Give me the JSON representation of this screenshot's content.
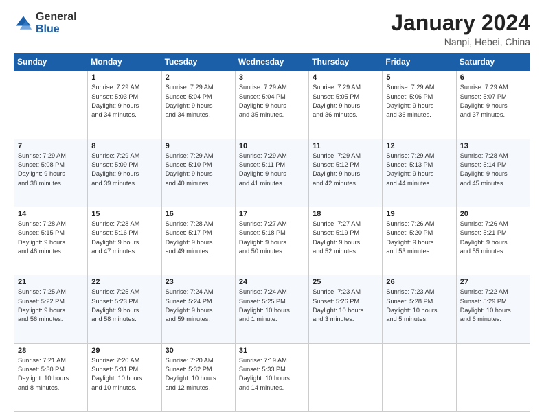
{
  "logo": {
    "general": "General",
    "blue": "Blue"
  },
  "header": {
    "month": "January 2024",
    "location": "Nanpi, Hebei, China"
  },
  "weekdays": [
    "Sunday",
    "Monday",
    "Tuesday",
    "Wednesday",
    "Thursday",
    "Friday",
    "Saturday"
  ],
  "weeks": [
    [
      {
        "day": "",
        "info": ""
      },
      {
        "day": "1",
        "info": "Sunrise: 7:29 AM\nSunset: 5:03 PM\nDaylight: 9 hours\nand 34 minutes."
      },
      {
        "day": "2",
        "info": "Sunrise: 7:29 AM\nSunset: 5:04 PM\nDaylight: 9 hours\nand 34 minutes."
      },
      {
        "day": "3",
        "info": "Sunrise: 7:29 AM\nSunset: 5:04 PM\nDaylight: 9 hours\nand 35 minutes."
      },
      {
        "day": "4",
        "info": "Sunrise: 7:29 AM\nSunset: 5:05 PM\nDaylight: 9 hours\nand 36 minutes."
      },
      {
        "day": "5",
        "info": "Sunrise: 7:29 AM\nSunset: 5:06 PM\nDaylight: 9 hours\nand 36 minutes."
      },
      {
        "day": "6",
        "info": "Sunrise: 7:29 AM\nSunset: 5:07 PM\nDaylight: 9 hours\nand 37 minutes."
      }
    ],
    [
      {
        "day": "7",
        "info": "Sunrise: 7:29 AM\nSunset: 5:08 PM\nDaylight: 9 hours\nand 38 minutes."
      },
      {
        "day": "8",
        "info": "Sunrise: 7:29 AM\nSunset: 5:09 PM\nDaylight: 9 hours\nand 39 minutes."
      },
      {
        "day": "9",
        "info": "Sunrise: 7:29 AM\nSunset: 5:10 PM\nDaylight: 9 hours\nand 40 minutes."
      },
      {
        "day": "10",
        "info": "Sunrise: 7:29 AM\nSunset: 5:11 PM\nDaylight: 9 hours\nand 41 minutes."
      },
      {
        "day": "11",
        "info": "Sunrise: 7:29 AM\nSunset: 5:12 PM\nDaylight: 9 hours\nand 42 minutes."
      },
      {
        "day": "12",
        "info": "Sunrise: 7:29 AM\nSunset: 5:13 PM\nDaylight: 9 hours\nand 44 minutes."
      },
      {
        "day": "13",
        "info": "Sunrise: 7:28 AM\nSunset: 5:14 PM\nDaylight: 9 hours\nand 45 minutes."
      }
    ],
    [
      {
        "day": "14",
        "info": "Sunrise: 7:28 AM\nSunset: 5:15 PM\nDaylight: 9 hours\nand 46 minutes."
      },
      {
        "day": "15",
        "info": "Sunrise: 7:28 AM\nSunset: 5:16 PM\nDaylight: 9 hours\nand 47 minutes."
      },
      {
        "day": "16",
        "info": "Sunrise: 7:28 AM\nSunset: 5:17 PM\nDaylight: 9 hours\nand 49 minutes."
      },
      {
        "day": "17",
        "info": "Sunrise: 7:27 AM\nSunset: 5:18 PM\nDaylight: 9 hours\nand 50 minutes."
      },
      {
        "day": "18",
        "info": "Sunrise: 7:27 AM\nSunset: 5:19 PM\nDaylight: 9 hours\nand 52 minutes."
      },
      {
        "day": "19",
        "info": "Sunrise: 7:26 AM\nSunset: 5:20 PM\nDaylight: 9 hours\nand 53 minutes."
      },
      {
        "day": "20",
        "info": "Sunrise: 7:26 AM\nSunset: 5:21 PM\nDaylight: 9 hours\nand 55 minutes."
      }
    ],
    [
      {
        "day": "21",
        "info": "Sunrise: 7:25 AM\nSunset: 5:22 PM\nDaylight: 9 hours\nand 56 minutes."
      },
      {
        "day": "22",
        "info": "Sunrise: 7:25 AM\nSunset: 5:23 PM\nDaylight: 9 hours\nand 58 minutes."
      },
      {
        "day": "23",
        "info": "Sunrise: 7:24 AM\nSunset: 5:24 PM\nDaylight: 9 hours\nand 59 minutes."
      },
      {
        "day": "24",
        "info": "Sunrise: 7:24 AM\nSunset: 5:25 PM\nDaylight: 10 hours\nand 1 minute."
      },
      {
        "day": "25",
        "info": "Sunrise: 7:23 AM\nSunset: 5:26 PM\nDaylight: 10 hours\nand 3 minutes."
      },
      {
        "day": "26",
        "info": "Sunrise: 7:23 AM\nSunset: 5:28 PM\nDaylight: 10 hours\nand 5 minutes."
      },
      {
        "day": "27",
        "info": "Sunrise: 7:22 AM\nSunset: 5:29 PM\nDaylight: 10 hours\nand 6 minutes."
      }
    ],
    [
      {
        "day": "28",
        "info": "Sunrise: 7:21 AM\nSunset: 5:30 PM\nDaylight: 10 hours\nand 8 minutes."
      },
      {
        "day": "29",
        "info": "Sunrise: 7:20 AM\nSunset: 5:31 PM\nDaylight: 10 hours\nand 10 minutes."
      },
      {
        "day": "30",
        "info": "Sunrise: 7:20 AM\nSunset: 5:32 PM\nDaylight: 10 hours\nand 12 minutes."
      },
      {
        "day": "31",
        "info": "Sunrise: 7:19 AM\nSunset: 5:33 PM\nDaylight: 10 hours\nand 14 minutes."
      },
      {
        "day": "",
        "info": ""
      },
      {
        "day": "",
        "info": ""
      },
      {
        "day": "",
        "info": ""
      }
    ]
  ]
}
